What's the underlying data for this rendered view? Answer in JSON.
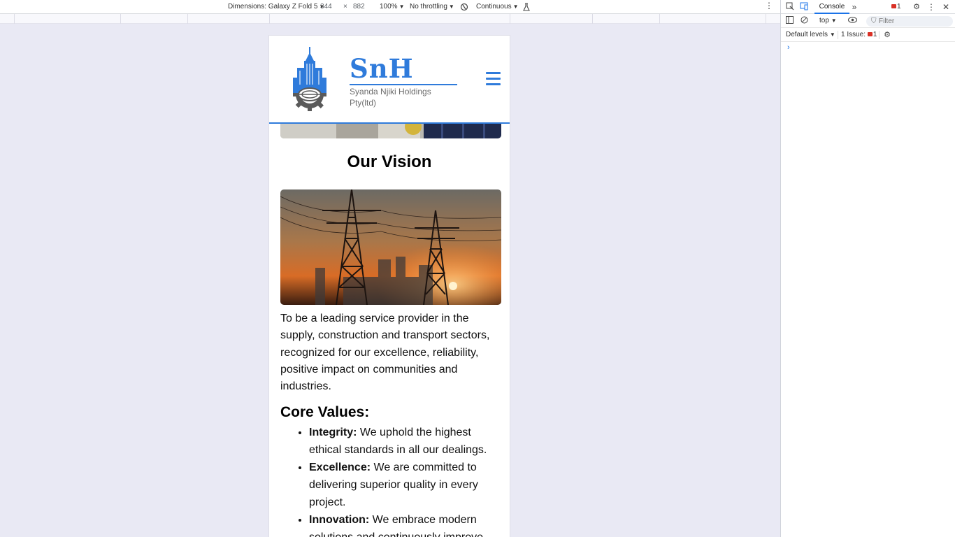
{
  "devtools_toolbar": {
    "dimensions_label": "Dimensions: Galaxy Z Fold 5",
    "width": "344",
    "times": "×",
    "height": "882",
    "zoom": "100%",
    "throttling": "No throttling",
    "mode": "Continuous"
  },
  "site": {
    "brand": "SnH",
    "subtitle": "Syanda Njiki Holdings Pty(ltd)",
    "section_title": "Our Vision",
    "vision_text": "To be a leading service provider in the supply, construction and transport sectors, recognized for our excellence, reliability, positive impact on communities and industries.",
    "core_values_title": "Core Values:",
    "core_values": [
      {
        "name": "Integrity:",
        "text": " We uphold the highest ethical standards in all our dealings."
      },
      {
        "name": "Excellence:",
        "text": " We are committed to delivering superior quality in every project."
      },
      {
        "name": "Innovation:",
        "text": " We embrace modern solutions and continuously improve"
      }
    ]
  },
  "devtools": {
    "tab_console": "Console",
    "error_count": "1",
    "context": "top",
    "filter_placeholder": "Filter",
    "levels": "Default levels",
    "issues_label": "1 Issue:",
    "issues_count": "1",
    "prompt": "›"
  },
  "colors": {
    "brand_blue": "#2f7bdb",
    "devtools_accent": "#1a73e8",
    "error_red": "#d93025"
  }
}
